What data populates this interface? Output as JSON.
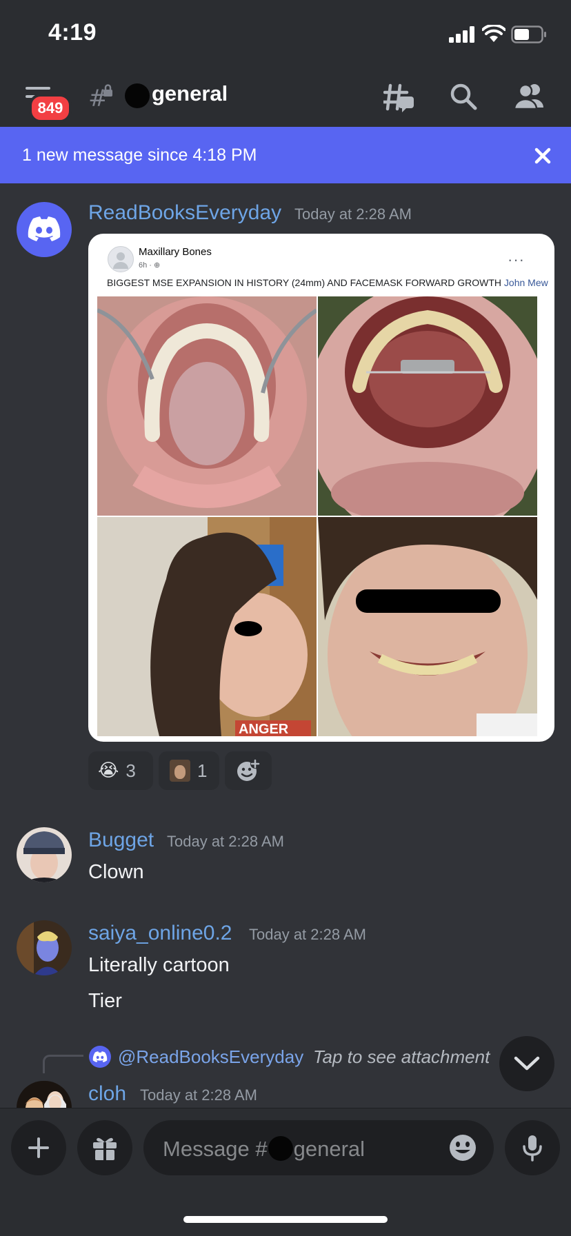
{
  "status_bar": {
    "time": "4:19"
  },
  "header": {
    "unread_count": "849",
    "channel_name": "general"
  },
  "banner": {
    "text": "1 new message since 4:18 PM"
  },
  "messages": [
    {
      "username": "ReadBooksEveryday",
      "timestamp": "Today at 2:28 AM",
      "embed": {
        "page_name": "Maxillary Bones",
        "post_time": "6h · ",
        "caption": "BIGGEST MSE EXPANSION IN HISTORY (24mm) AND FACEMASK FORWARD GROWTH ",
        "caption_link": "John Mew",
        "sign_text": "ANGER"
      },
      "reactions": [
        {
          "emoji": "😭",
          "count": "3"
        },
        {
          "emoji": "custom",
          "count": "1"
        }
      ]
    },
    {
      "username": "Bugget",
      "timestamp": "Today at 2:28 AM",
      "lines": [
        "Clown"
      ]
    },
    {
      "username": "saiya_online0.2",
      "timestamp": "Today at 2:28 AM",
      "lines": [
        "Literally cartoon",
        "Tier"
      ]
    },
    {
      "reply": {
        "mention": "@ReadBooksEveryday",
        "note": "Tap to see attachment"
      },
      "username": "cloh",
      "timestamp": "Today at 2:28 AM"
    }
  ],
  "composer": {
    "placeholder_prefix": "Message #",
    "placeholder_channel": "general"
  },
  "colors": {
    "background": "#313338",
    "header": "#2b2d31",
    "blurple": "#5865f2",
    "badge": "#f23f43",
    "username": "#6ea5e6"
  }
}
